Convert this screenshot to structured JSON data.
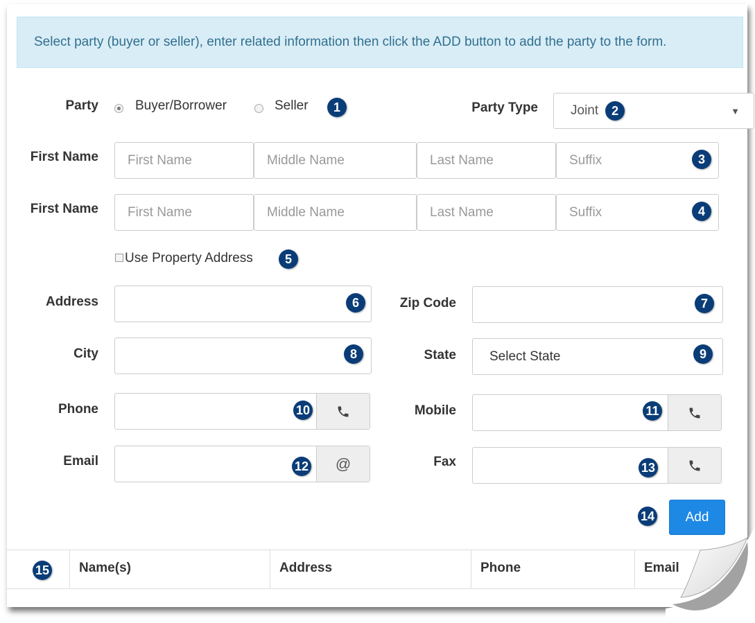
{
  "info_text": "Select party (buyer or seller), enter related information then click the ADD button to add the party to the form.",
  "party": {
    "label": "Party",
    "options": [
      "Buyer/Borrower",
      "Seller"
    ],
    "selected": "Buyer/Borrower"
  },
  "party_type": {
    "label": "Party Type",
    "value": "Joint"
  },
  "name_row1": {
    "label": "First Name",
    "placeholders": [
      "First Name",
      "Middle Name",
      "Last Name",
      "Suffix"
    ]
  },
  "name_row2": {
    "label": "First Name",
    "placeholders": [
      "First Name",
      "Middle Name",
      "Last Name",
      "Suffix"
    ]
  },
  "use_property": {
    "label": "Use Property Address",
    "checked": false
  },
  "address": {
    "label": "Address",
    "value": ""
  },
  "zip": {
    "label": "Zip Code",
    "value": ""
  },
  "city": {
    "label": "City",
    "value": ""
  },
  "state": {
    "label": "State",
    "value": "Select State"
  },
  "phone": {
    "label": "Phone",
    "value": "",
    "icon": "phone-icon"
  },
  "mobile": {
    "label": "Mobile",
    "value": "",
    "icon": "phone-icon"
  },
  "email": {
    "label": "Email",
    "value": "",
    "icon": "at-icon",
    "addon": "@"
  },
  "fax": {
    "label": "Fax",
    "value": "",
    "icon": "phone-icon"
  },
  "add_button": "Add",
  "table_headers": [
    "Name(s)",
    "Address",
    "Phone",
    "Email"
  ],
  "badges": [
    "1",
    "2",
    "3",
    "4",
    "5",
    "6",
    "7",
    "8",
    "9",
    "10",
    "11",
    "12",
    "13",
    "14",
    "15"
  ],
  "colors": {
    "badge": "#0a3d78",
    "info_bg": "#d9edf7",
    "info_text": "#31708f",
    "button": "#1e88e5"
  }
}
